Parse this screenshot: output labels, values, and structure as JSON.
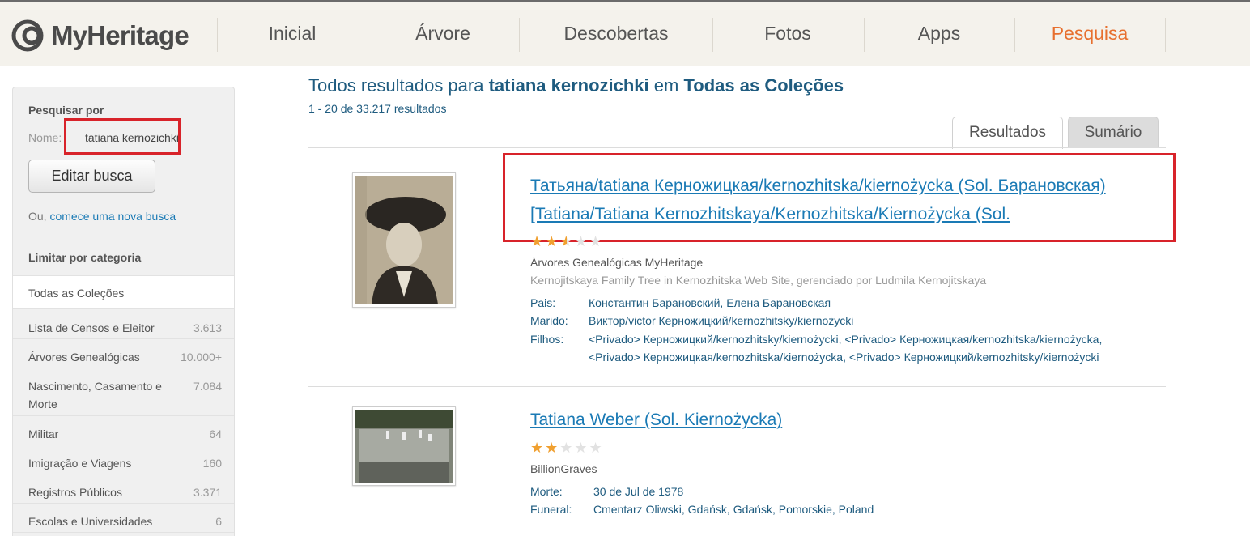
{
  "brand": {
    "name": "MyHeritage"
  },
  "nav": {
    "items": [
      {
        "label": "Inicial"
      },
      {
        "label": "Árvore"
      },
      {
        "label": "Descobertas"
      },
      {
        "label": "Fotos"
      },
      {
        "label": "Apps"
      },
      {
        "label": "Pesquisa"
      }
    ],
    "active_color": "#e76f2e"
  },
  "sidebar": {
    "title": "Pesquisar por",
    "name_label": "Nome:",
    "name_value": "tatiana kernozichki",
    "edit_button": "Editar busca",
    "or_text": "Ou,",
    "new_search_link": "comece uma nova busca",
    "category_title": "Limitar por categoria",
    "selected_category": "Todas as Coleções",
    "categories": [
      {
        "label": "Lista de Censos e Eleitor",
        "count": "3.613"
      },
      {
        "label": "Árvores Genealógicas",
        "count": "10.000+"
      },
      {
        "label": "Nascimento, Casamento e Morte",
        "count": "7.084"
      },
      {
        "label": "Militar",
        "count": "64"
      },
      {
        "label": "Imigração e Viagens",
        "count": "160"
      },
      {
        "label": "Registros Públicos",
        "count": "3.371"
      },
      {
        "label": "Escolas e Universidades",
        "count": "6"
      }
    ]
  },
  "results": {
    "title_prefix": "Todos resultados para",
    "query": "tatiana kernozichki",
    "title_mid": "em",
    "collection": "Todas as Coleções",
    "count_text": "1 - 20 de 33.217 resultados",
    "tabs": [
      {
        "label": "Resultados"
      },
      {
        "label": "Sumário"
      }
    ],
    "records": [
      {
        "title_line1": "Татьяна/tatiana Керножицкая/kernozhitska/kiernożycka (Sol. Барановская)",
        "title_line2": "[Tatiana/Tatiana Kernozhitskaya/Kernozhitska/Kiernożycka (Sol.",
        "stars": 2.5,
        "source": "Árvores Genealógicas MyHeritage",
        "source_detail": "Kernojitskaya Family Tree in Kernozhitska Web Site, gerenciado por Ludmila Kernojitskaya",
        "fields": [
          {
            "label": "Pais:",
            "value": "Константин Барановский, Елена Барановская"
          },
          {
            "label": "Marido:",
            "value": "Виктор/victor Керножицкий/kernozhitsky/kiernożycki"
          },
          {
            "label": "Filhos:",
            "value": "<Privado> Керножицкий/kernozhitsky/kiernożycki, <Privado> Керножицкая/kernozhitska/kiernożycka,",
            "value2": "<Privado> Керножицкая/kernozhitska/kiernożycka, <Privado> Керножицкий/kernozhitsky/kiernożycki"
          }
        ]
      },
      {
        "title_line1": "Tatiana Weber (Sol. Kiernożycka)",
        "stars": 2,
        "source": "BillionGraves",
        "fields": [
          {
            "label": "Morte:",
            "value": "30 de Jul de 1978"
          },
          {
            "label": "Funeral:",
            "value": "Cmentarz Oliwski, Gdańsk, Gdańsk, Pomorskie, Poland"
          }
        ]
      }
    ]
  },
  "highlight_color": "#d8232a"
}
